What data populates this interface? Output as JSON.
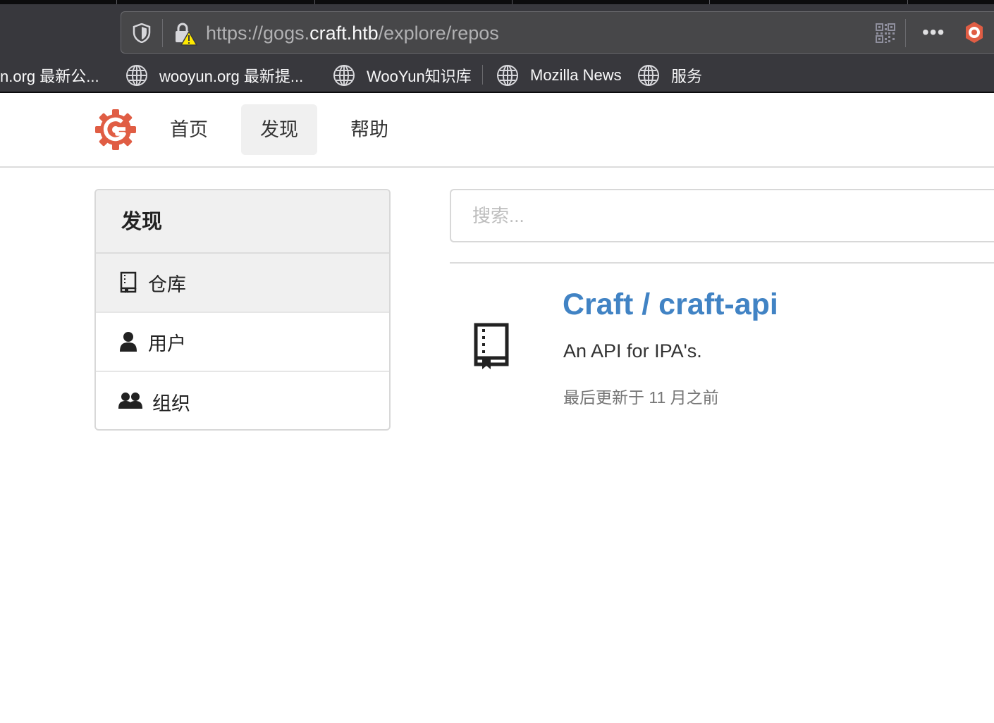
{
  "browser": {
    "url_prefix": "https://gogs.",
    "url_host": "craft.htb",
    "url_path": "/explore/repos",
    "more_label": "•••",
    "bookmarks": [
      {
        "label": "n.org 最新公..."
      },
      {
        "label": "wooyun.org 最新提..."
      },
      {
        "label": "WooYun知识库"
      },
      {
        "label": "Mozilla News"
      },
      {
        "label": "服务"
      }
    ]
  },
  "header": {
    "nav": [
      {
        "label": "首页"
      },
      {
        "label": "发现"
      },
      {
        "label": "帮助"
      }
    ]
  },
  "sidebar": {
    "title": "发现",
    "items": [
      {
        "label": "仓库",
        "icon": "repo-icon"
      },
      {
        "label": "用户",
        "icon": "person-icon"
      },
      {
        "label": "组织",
        "icon": "organization-icon"
      }
    ]
  },
  "search": {
    "placeholder": "搜索..."
  },
  "repos": [
    {
      "title": "Craft / craft-api",
      "description": "An API for IPA's.",
      "updated": "最后更新于 11 月之前"
    }
  ],
  "colors": {
    "link": "#4183c4",
    "logo": "#e05d44",
    "chrome": "#38383d"
  }
}
